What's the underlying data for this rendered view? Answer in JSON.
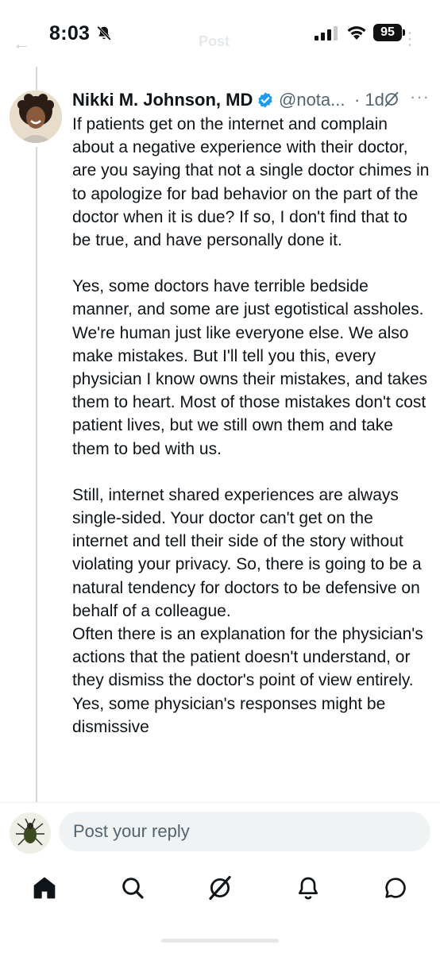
{
  "status_bar": {
    "time": "8:03",
    "battery": "95",
    "ghost_title": "Post"
  },
  "tweet": {
    "author_name": "Nikki M. Johnson, MD",
    "handle": "@nota...",
    "time_ago": "· 1d",
    "paragraphs": [
      "If patients get on the internet and complain about a negative experience with their doctor, are you saying that not a single doctor chimes in to apologize for bad behavior on the part of the doctor when it is due? If so, I don't find that to be true, and have personally done it.",
      "Yes, some doctors have terrible bedside manner, and some are just egotistical assholes. We're human just like everyone else. We also make mistakes. But I'll tell you this, every physician I know owns their mistakes, and takes them to heart. Most of those mistakes don't cost patient lives, but we still own them and take them to bed with us.",
      "Still, internet shared experiences are always single-sided. Your doctor can't get on the internet and tell their side of the story without violating your privacy. So, there is going to be a natural tendency for doctors to be defensive on behalf of a colleague.",
      "Often there is an explanation for the physician's actions that the patient doesn't understand, or they dismiss the doctor's point of view entirely. Yes, some physician's responses might be dismissive"
    ]
  },
  "reply": {
    "placeholder": "Post your reply"
  },
  "colors": {
    "accent": "#1d9bf0",
    "text": "#0f1419",
    "secondary": "#536471"
  },
  "nav": {
    "icons": [
      "home-icon",
      "search-icon",
      "grok-icon",
      "notifications-icon",
      "messages-icon"
    ]
  }
}
